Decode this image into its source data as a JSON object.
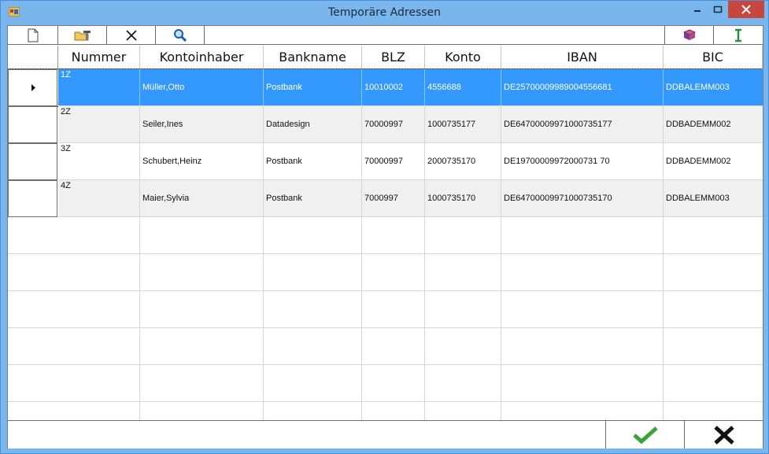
{
  "window": {
    "title": "Temporäre Adressen"
  },
  "toolbar": {
    "left_buttons": [
      "new-document-icon",
      "edit-folder-icon",
      "delete-icon",
      "search-icon"
    ],
    "right_buttons": [
      "book-icon",
      "text-cursor-icon"
    ]
  },
  "table": {
    "columns": [
      "Nummer",
      "Kontoinhaber",
      "Bankname",
      "BLZ",
      "Konto",
      "IBAN",
      "BIC"
    ],
    "rows": [
      {
        "nummer": "1Z",
        "kontoinhaber": "Müller,Otto",
        "bankname": "Postbank",
        "blz": "10010002",
        "konto": "4556688",
        "iban": "DE25700009989004556681",
        "bic": "DDBALEMM003"
      },
      {
        "nummer": "2Z",
        "kontoinhaber": "Seiler,Ines",
        "bankname": "Datadesign",
        "blz": "70000997",
        "konto": "1000735177",
        "iban": "DE64700009971000735177",
        "bic": "DDBADEMM002"
      },
      {
        "nummer": "3Z",
        "kontoinhaber": "Schubert,Heinz",
        "bankname": "Postbank",
        "blz": "70000997",
        "konto": "2000735170",
        "iban": "DE19700009972000731 70",
        "bic": "DDBADEMM002"
      },
      {
        "nummer": "4Z",
        "kontoinhaber": "Maier,Sylvia",
        "bankname": "Postbank",
        "blz": "7000997",
        "konto": "1000735170",
        "iban": "DE64700009971000735170",
        "bic": "DDBALEMM003"
      }
    ],
    "selected_row": 0
  },
  "footer": {
    "ok_icon": "checkmark-icon",
    "cancel_icon": "x-icon"
  },
  "colors": {
    "titlebar": "#79b6ee",
    "selection": "#3399ff",
    "close": "#c7463e",
    "ok": "#3aa33a"
  }
}
